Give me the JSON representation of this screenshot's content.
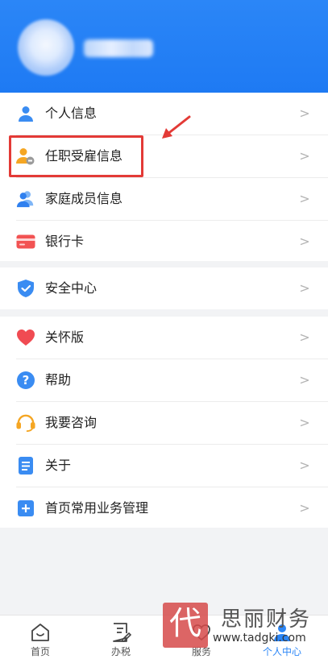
{
  "header": {
    "bg_color": "#2b86f7"
  },
  "menu_group_1": [
    {
      "label": "个人信息",
      "icon": "person-icon",
      "color": "#3a8cf2"
    },
    {
      "label": "任职受雇信息",
      "icon": "employee-badge-icon",
      "color": "#f5a623"
    },
    {
      "label": "家庭成员信息",
      "icon": "family-icon",
      "color": "#3a8cf2"
    },
    {
      "label": "银行卡",
      "icon": "bank-card-icon",
      "color": "#f25353"
    }
  ],
  "menu_group_2": [
    {
      "label": "安全中心",
      "icon": "shield-icon",
      "color": "#3a8cf2"
    }
  ],
  "menu_group_3": [
    {
      "label": "关怀版",
      "icon": "heart-icon",
      "color": "#f04b52"
    },
    {
      "label": "帮助",
      "icon": "question-icon",
      "color": "#3a8cf2"
    },
    {
      "label": "我要咨询",
      "icon": "headset-icon",
      "color": "#f5a623"
    },
    {
      "label": "关于",
      "icon": "document-icon",
      "color": "#3a8cf2"
    },
    {
      "label": "首页常用业务管理",
      "icon": "plus-square-icon",
      "color": "#3a8cf2"
    }
  ],
  "chevron": ">",
  "tabs": [
    {
      "label": "首页",
      "icon": "home-icon",
      "active": false
    },
    {
      "label": "办税",
      "icon": "tax-doc-icon",
      "active": false
    },
    {
      "label": "服务",
      "icon": "service-icon",
      "active": false
    },
    {
      "label": "个人中心",
      "icon": "person-icon",
      "active": true
    }
  ],
  "watermark": {
    "stamp_char": "代",
    "title": "思丽财务",
    "url": "www.tadgki.com"
  },
  "annotation": {
    "highlight_color": "#e33a36"
  }
}
